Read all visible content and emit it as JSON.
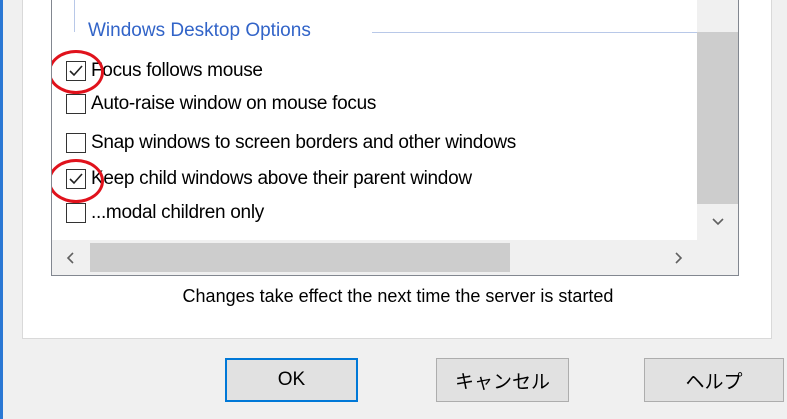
{
  "group": {
    "title": "Windows Desktop Options"
  },
  "options": [
    {
      "label": "Focus follows mouse",
      "checked": true,
      "highlighted": true
    },
    {
      "label": "Auto-raise window on mouse focus",
      "checked": false,
      "highlighted": false
    },
    {
      "label": "Snap windows to screen borders and other windows",
      "checked": false,
      "highlighted": false
    },
    {
      "label": "Keep child windows above their parent window",
      "checked": true,
      "highlighted": true
    },
    {
      "label": "...modal children only",
      "checked": false,
      "highlighted": false
    }
  ],
  "note": "Changes take effect the next time the server is started",
  "buttons": {
    "ok": "OK",
    "cancel": "キャンセル",
    "help": "ヘルプ"
  },
  "colors": {
    "group_title": "#3264c8",
    "annotation": "#e0121c",
    "default_button_border": "#0078d7"
  },
  "icons": {
    "scroll_down": "chevron-down-icon",
    "scroll_left": "chevron-left-icon",
    "scroll_right": "chevron-right-icon",
    "check": "checkmark-icon"
  }
}
